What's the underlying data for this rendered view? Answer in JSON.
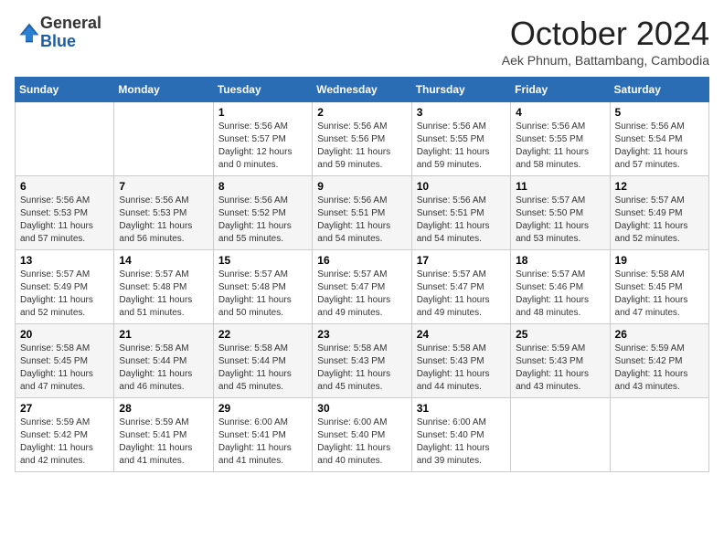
{
  "logo": {
    "general": "General",
    "blue": "Blue"
  },
  "title": "October 2024",
  "location": "Aek Phnum, Battambang, Cambodia",
  "headers": [
    "Sunday",
    "Monday",
    "Tuesday",
    "Wednesday",
    "Thursday",
    "Friday",
    "Saturday"
  ],
  "weeks": [
    [
      {
        "day": "",
        "info": ""
      },
      {
        "day": "",
        "info": ""
      },
      {
        "day": "1",
        "info": "Sunrise: 5:56 AM\nSunset: 5:57 PM\nDaylight: 12 hours\nand 0 minutes."
      },
      {
        "day": "2",
        "info": "Sunrise: 5:56 AM\nSunset: 5:56 PM\nDaylight: 11 hours\nand 59 minutes."
      },
      {
        "day": "3",
        "info": "Sunrise: 5:56 AM\nSunset: 5:55 PM\nDaylight: 11 hours\nand 59 minutes."
      },
      {
        "day": "4",
        "info": "Sunrise: 5:56 AM\nSunset: 5:55 PM\nDaylight: 11 hours\nand 58 minutes."
      },
      {
        "day": "5",
        "info": "Sunrise: 5:56 AM\nSunset: 5:54 PM\nDaylight: 11 hours\nand 57 minutes."
      }
    ],
    [
      {
        "day": "6",
        "info": "Sunrise: 5:56 AM\nSunset: 5:53 PM\nDaylight: 11 hours\nand 57 minutes."
      },
      {
        "day": "7",
        "info": "Sunrise: 5:56 AM\nSunset: 5:53 PM\nDaylight: 11 hours\nand 56 minutes."
      },
      {
        "day": "8",
        "info": "Sunrise: 5:56 AM\nSunset: 5:52 PM\nDaylight: 11 hours\nand 55 minutes."
      },
      {
        "day": "9",
        "info": "Sunrise: 5:56 AM\nSunset: 5:51 PM\nDaylight: 11 hours\nand 54 minutes."
      },
      {
        "day": "10",
        "info": "Sunrise: 5:56 AM\nSunset: 5:51 PM\nDaylight: 11 hours\nand 54 minutes."
      },
      {
        "day": "11",
        "info": "Sunrise: 5:57 AM\nSunset: 5:50 PM\nDaylight: 11 hours\nand 53 minutes."
      },
      {
        "day": "12",
        "info": "Sunrise: 5:57 AM\nSunset: 5:49 PM\nDaylight: 11 hours\nand 52 minutes."
      }
    ],
    [
      {
        "day": "13",
        "info": "Sunrise: 5:57 AM\nSunset: 5:49 PM\nDaylight: 11 hours\nand 52 minutes."
      },
      {
        "day": "14",
        "info": "Sunrise: 5:57 AM\nSunset: 5:48 PM\nDaylight: 11 hours\nand 51 minutes."
      },
      {
        "day": "15",
        "info": "Sunrise: 5:57 AM\nSunset: 5:48 PM\nDaylight: 11 hours\nand 50 minutes."
      },
      {
        "day": "16",
        "info": "Sunrise: 5:57 AM\nSunset: 5:47 PM\nDaylight: 11 hours\nand 49 minutes."
      },
      {
        "day": "17",
        "info": "Sunrise: 5:57 AM\nSunset: 5:47 PM\nDaylight: 11 hours\nand 49 minutes."
      },
      {
        "day": "18",
        "info": "Sunrise: 5:57 AM\nSunset: 5:46 PM\nDaylight: 11 hours\nand 48 minutes."
      },
      {
        "day": "19",
        "info": "Sunrise: 5:58 AM\nSunset: 5:45 PM\nDaylight: 11 hours\nand 47 minutes."
      }
    ],
    [
      {
        "day": "20",
        "info": "Sunrise: 5:58 AM\nSunset: 5:45 PM\nDaylight: 11 hours\nand 47 minutes."
      },
      {
        "day": "21",
        "info": "Sunrise: 5:58 AM\nSunset: 5:44 PM\nDaylight: 11 hours\nand 46 minutes."
      },
      {
        "day": "22",
        "info": "Sunrise: 5:58 AM\nSunset: 5:44 PM\nDaylight: 11 hours\nand 45 minutes."
      },
      {
        "day": "23",
        "info": "Sunrise: 5:58 AM\nSunset: 5:43 PM\nDaylight: 11 hours\nand 45 minutes."
      },
      {
        "day": "24",
        "info": "Sunrise: 5:58 AM\nSunset: 5:43 PM\nDaylight: 11 hours\nand 44 minutes."
      },
      {
        "day": "25",
        "info": "Sunrise: 5:59 AM\nSunset: 5:43 PM\nDaylight: 11 hours\nand 43 minutes."
      },
      {
        "day": "26",
        "info": "Sunrise: 5:59 AM\nSunset: 5:42 PM\nDaylight: 11 hours\nand 43 minutes."
      }
    ],
    [
      {
        "day": "27",
        "info": "Sunrise: 5:59 AM\nSunset: 5:42 PM\nDaylight: 11 hours\nand 42 minutes."
      },
      {
        "day": "28",
        "info": "Sunrise: 5:59 AM\nSunset: 5:41 PM\nDaylight: 11 hours\nand 41 minutes."
      },
      {
        "day": "29",
        "info": "Sunrise: 6:00 AM\nSunset: 5:41 PM\nDaylight: 11 hours\nand 41 minutes."
      },
      {
        "day": "30",
        "info": "Sunrise: 6:00 AM\nSunset: 5:40 PM\nDaylight: 11 hours\nand 40 minutes."
      },
      {
        "day": "31",
        "info": "Sunrise: 6:00 AM\nSunset: 5:40 PM\nDaylight: 11 hours\nand 39 minutes."
      },
      {
        "day": "",
        "info": ""
      },
      {
        "day": "",
        "info": ""
      }
    ]
  ]
}
